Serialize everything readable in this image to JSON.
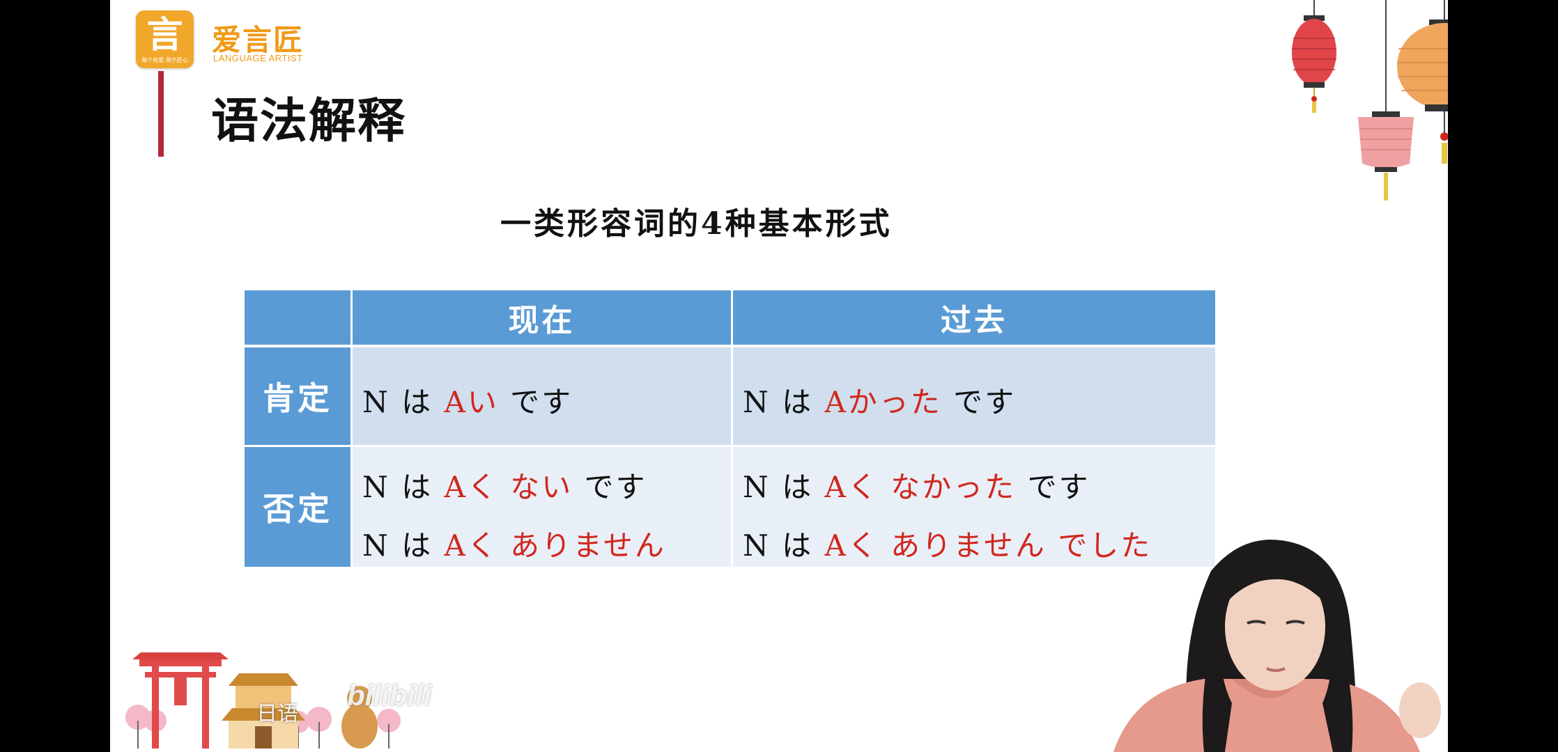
{
  "brand": {
    "logo_glyph": "言",
    "logo_slogan": "每个热爱 用于匠心",
    "name_cn": "爱言匠",
    "name_en": "LANGUAGE ARTIST"
  },
  "section_title": "语法解释",
  "headline": "一类形容词的4种基本形式",
  "table": {
    "col_headers": [
      "现在",
      "过去"
    ],
    "rows": [
      {
        "label": "肯定",
        "present": [
          {
            "prefix": "N は ",
            "red": "Aい",
            "suffix": " です"
          }
        ],
        "past": [
          {
            "prefix": "N は ",
            "red": "Aかった",
            "suffix": " です"
          }
        ]
      },
      {
        "label": "否定",
        "present": [
          {
            "prefix": "N は ",
            "red": "Aく ない",
            "suffix": " です"
          },
          {
            "prefix": "N は ",
            "red": "Aく ありません",
            "suffix": ""
          }
        ],
        "past": [
          {
            "prefix": "N は ",
            "red": "Aく なかった",
            "suffix": " です"
          },
          {
            "prefix": "N は ",
            "red": "Aく ありません でした",
            "suffix": ""
          }
        ]
      }
    ]
  },
  "watermark": {
    "logo": "bilibili",
    "channel": "日语"
  },
  "colors": {
    "brand_orange": "#f09a18",
    "accent_bar": "#b3263b",
    "table_header": "#5b9bd5",
    "row_light": "#d0deee",
    "row_lighter": "#e9eff7",
    "emphasis_red": "#d0271d"
  },
  "icons": [
    "lantern-icon",
    "pagoda-icon",
    "bilibili-logo"
  ]
}
